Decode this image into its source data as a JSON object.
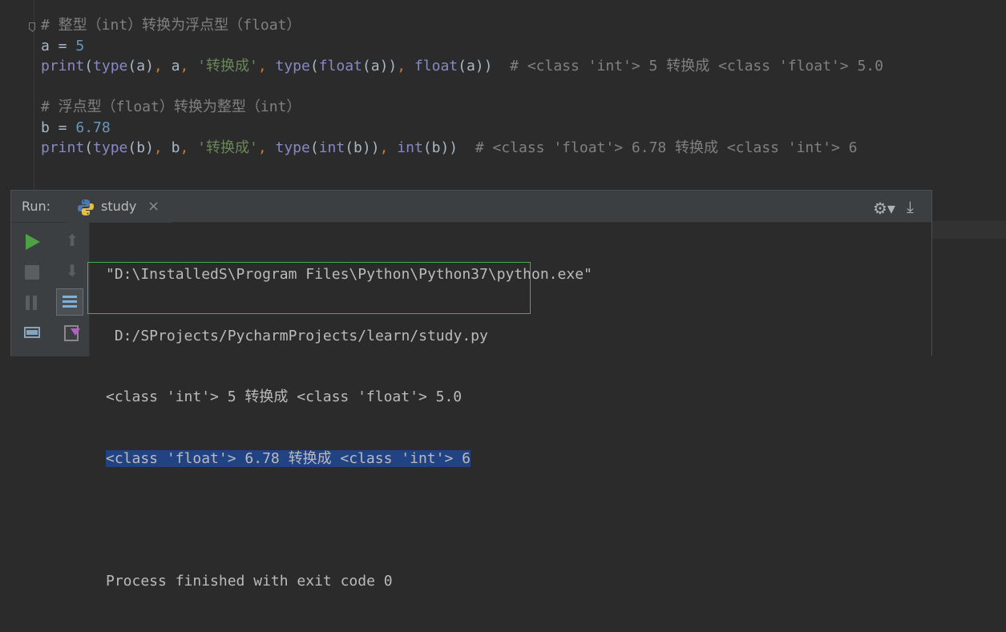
{
  "editor": {
    "lines": [
      {
        "parts": [
          {
            "t": "# 整型（int）转换为浮点型（float）",
            "c": "c-cmt"
          }
        ]
      },
      {
        "parts": [
          {
            "t": "a = ",
            "c": "c-var"
          },
          {
            "t": "5",
            "c": "c-num"
          }
        ]
      },
      {
        "parts": [
          {
            "t": "print",
            "c": "c-fn"
          },
          {
            "t": "(",
            "c": "c-var"
          },
          {
            "t": "type",
            "c": "c-fn"
          },
          {
            "t": "(a)",
            "c": "c-var"
          },
          {
            "t": ", ",
            "c": "c-punc"
          },
          {
            "t": "a",
            "c": "c-var"
          },
          {
            "t": ", ",
            "c": "c-punc"
          },
          {
            "t": "'转换成'",
            "c": "c-str"
          },
          {
            "t": ", ",
            "c": "c-punc"
          },
          {
            "t": "type",
            "c": "c-fn"
          },
          {
            "t": "(",
            "c": "c-var"
          },
          {
            "t": "float",
            "c": "c-fn"
          },
          {
            "t": "(a))",
            "c": "c-var"
          },
          {
            "t": ", ",
            "c": "c-punc"
          },
          {
            "t": "float",
            "c": "c-fn"
          },
          {
            "t": "(a))  ",
            "c": "c-var"
          },
          {
            "t": "# <class 'int'> 5 转换成 <class 'float'> 5.0",
            "c": "c-cmt"
          }
        ]
      },
      {
        "parts": [
          {
            "t": "",
            "c": "c-var"
          }
        ]
      },
      {
        "parts": [
          {
            "t": "# 浮点型（float）转换为整型（int）",
            "c": "c-cmt"
          }
        ]
      },
      {
        "parts": [
          {
            "t": "b = ",
            "c": "c-var"
          },
          {
            "t": "6.78",
            "c": "c-num"
          }
        ]
      },
      {
        "parts": [
          {
            "t": "print",
            "c": "c-fn"
          },
          {
            "t": "(",
            "c": "c-var"
          },
          {
            "t": "type",
            "c": "c-fn"
          },
          {
            "t": "(b)",
            "c": "c-var"
          },
          {
            "t": ", ",
            "c": "c-punc"
          },
          {
            "t": "b",
            "c": "c-var"
          },
          {
            "t": ", ",
            "c": "c-punc"
          },
          {
            "t": "'转换成'",
            "c": "c-str"
          },
          {
            "t": ", ",
            "c": "c-punc"
          },
          {
            "t": "type",
            "c": "c-fn"
          },
          {
            "t": "(",
            "c": "c-var"
          },
          {
            "t": "int",
            "c": "c-fn"
          },
          {
            "t": "(b))",
            "c": "c-var"
          },
          {
            "t": ", ",
            "c": "c-punc"
          },
          {
            "t": "int",
            "c": "c-fn"
          },
          {
            "t": "(b))  ",
            "c": "c-var"
          },
          {
            "t": "# <class 'float'> 6.78 转换成 <class 'int'> 6",
            "c": "c-cmt"
          }
        ]
      }
    ]
  },
  "run": {
    "label": "Run:",
    "tab_name": "study",
    "close_symbol": "×",
    "gear_symbol": "⚙▾",
    "pin_symbol": "⤓",
    "up_symbol": "⬆",
    "down_symbol": "⬇"
  },
  "console": {
    "line1": "\"D:\\InstalledS\\Program Files\\Python\\Python37\\python.exe\"",
    "line2": " D:/SProjects/PycharmProjects/learn/study.py",
    "line3": "<class 'int'> 5 转换成 <class 'float'> 5.0",
    "line4": "<class 'float'> 6.78 转换成 <class 'int'> 6",
    "line5": "",
    "line6": "Process finished with exit code 0"
  },
  "colors": {
    "background": "#2b2b2b",
    "panel": "#3c3f41",
    "selection": "#214283",
    "highlight_box": "#3fae4b",
    "run_green": "#4fa146"
  }
}
